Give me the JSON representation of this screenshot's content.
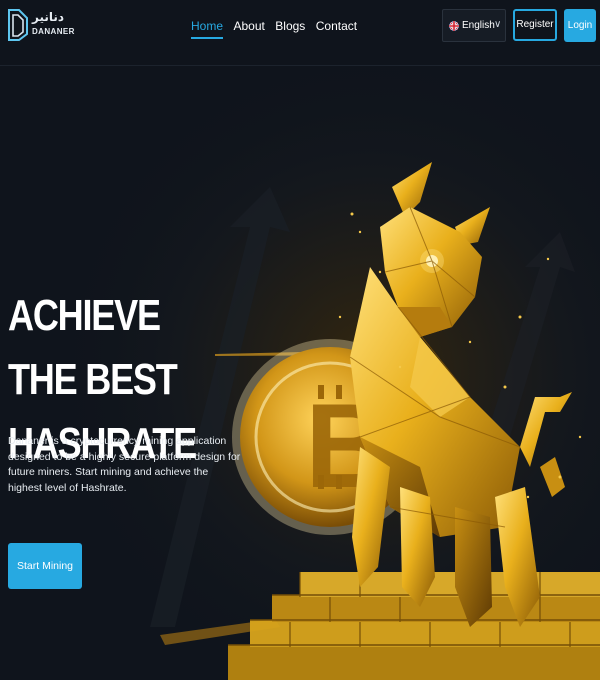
{
  "logo": {
    "arabic": "دنانير",
    "name": "DANANER",
    "icon": "dananer-logo-icon"
  },
  "nav": {
    "items": [
      "Home",
      "About",
      "Blogs",
      "Contact"
    ],
    "active_index": 0
  },
  "language": {
    "label": "English",
    "flag_icon": "uk-flag-icon",
    "chevron_icon": "chevron-down-icon"
  },
  "auth": {
    "register_label": "Register",
    "login_label": "Login"
  },
  "hero": {
    "title": "ACHIEVE THE BEST HASHRATE",
    "description": "Dananer is a cryptocurrency mining application designed to be a highly secure platform design for future miners. Start mining and achieve the highest level of Hashrate.",
    "cta_label": "Start Mining",
    "image_icon": "golden-bull-bitcoin-illustration"
  },
  "colors": {
    "accent": "#27a9e1",
    "background": "#0f141c",
    "gold": "#e9b01c"
  }
}
